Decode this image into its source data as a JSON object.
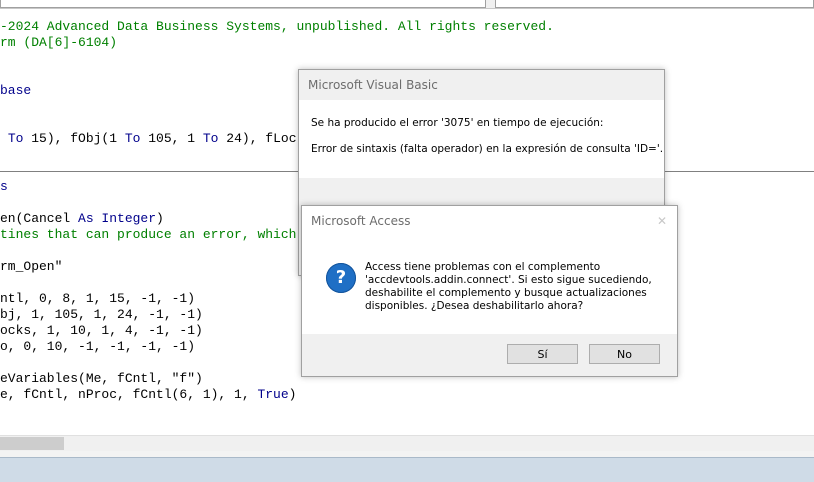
{
  "code": {
    "lines": [
      {
        "segments": [
          {
            "t": "-2024 Advanced Data Business Systems, unpublished. All rights reserved.",
            "c": "green"
          }
        ]
      },
      {
        "segments": [
          {
            "t": "rm (DA[6]-6104)",
            "c": "green"
          }
        ]
      },
      {
        "segments": [
          {
            "t": "",
            "c": ""
          }
        ]
      },
      {
        "segments": [
          {
            "t": "",
            "c": ""
          }
        ]
      },
      {
        "segments": [
          {
            "t": "base",
            "c": "blue"
          }
        ]
      },
      {
        "segments": [
          {
            "t": "",
            "c": ""
          }
        ]
      },
      {
        "segments": [
          {
            "t": "",
            "c": ""
          }
        ]
      },
      {
        "segments": [
          {
            "t": " ",
            "c": ""
          },
          {
            "t": "To",
            "c": "blue"
          },
          {
            "t": " 15), fObj(1 ",
            "c": ""
          },
          {
            "t": "To",
            "c": "blue"
          },
          {
            "t": " 105, 1 ",
            "c": ""
          },
          {
            "t": "To",
            "c": "blue"
          },
          {
            "t": " 24), fLoc",
            "c": ""
          }
        ]
      },
      {
        "segments": [
          {
            "t": "",
            "c": ""
          }
        ]
      },
      {
        "segments": [
          {
            "t": "",
            "c": ""
          }
        ]
      },
      {
        "segments": [
          {
            "t": "s",
            "c": "blue"
          }
        ]
      },
      {
        "segments": [
          {
            "t": "",
            "c": ""
          }
        ]
      },
      {
        "segments": [
          {
            "t": "en(Cancel ",
            "c": ""
          },
          {
            "t": "As Integer",
            "c": "blue"
          },
          {
            "t": ")",
            "c": ""
          }
        ]
      },
      {
        "segments": [
          {
            "t": "tines that can produce an error, which",
            "c": "green"
          }
        ]
      },
      {
        "segments": [
          {
            "t": "",
            "c": ""
          }
        ]
      },
      {
        "segments": [
          {
            "t": "rm_Open\"",
            "c": ""
          }
        ]
      },
      {
        "segments": [
          {
            "t": "",
            "c": ""
          }
        ]
      },
      {
        "segments": [
          {
            "t": "ntl, 0, 8, 1, 15, -1, -1)",
            "c": ""
          }
        ]
      },
      {
        "segments": [
          {
            "t": "bj, 1, 105, 1, 24, -1, -1)",
            "c": ""
          }
        ]
      },
      {
        "segments": [
          {
            "t": "ocks, 1, 10, 1, 4, -1, -1)",
            "c": ""
          }
        ]
      },
      {
        "segments": [
          {
            "t": "o, 0, 10, -1, -1, -1, -1)",
            "c": ""
          }
        ]
      },
      {
        "segments": [
          {
            "t": "",
            "c": ""
          }
        ]
      },
      {
        "segments": [
          {
            "t": "eVariables(Me, fCntl, \"f\")",
            "c": ""
          }
        ]
      },
      {
        "segments": [
          {
            "t": "e, fCntl, nProc, fCntl(6, 1), 1, ",
            "c": ""
          },
          {
            "t": "True",
            "c": "blue"
          },
          {
            "t": ")",
            "c": ""
          }
        ]
      }
    ]
  },
  "vb_dialog": {
    "title": "Microsoft Visual Basic",
    "line1": "Se ha producido el error '3075' en tiempo de ejecución:",
    "line2": "Error de sintaxis (falta operador) en la expresión de consulta 'ID='."
  },
  "access_dialog": {
    "title": "Microsoft Access",
    "close": "✕",
    "icon": "question-icon",
    "icon_glyph": "?",
    "message_lines": [
      "Access tiene problemas con el complemento",
      "'accdevtools.addin.connect'. Si esto sigue sucediendo,",
      "deshabilite el complemento y busque actualizaciones",
      "disponibles. ¿Desea deshabilitarlo ahora?"
    ],
    "yes_label": "Sí",
    "no_label": "No"
  },
  "colors": {
    "comment": "#008000",
    "keyword": "#00008b",
    "question_icon": "#1f6fc5"
  }
}
